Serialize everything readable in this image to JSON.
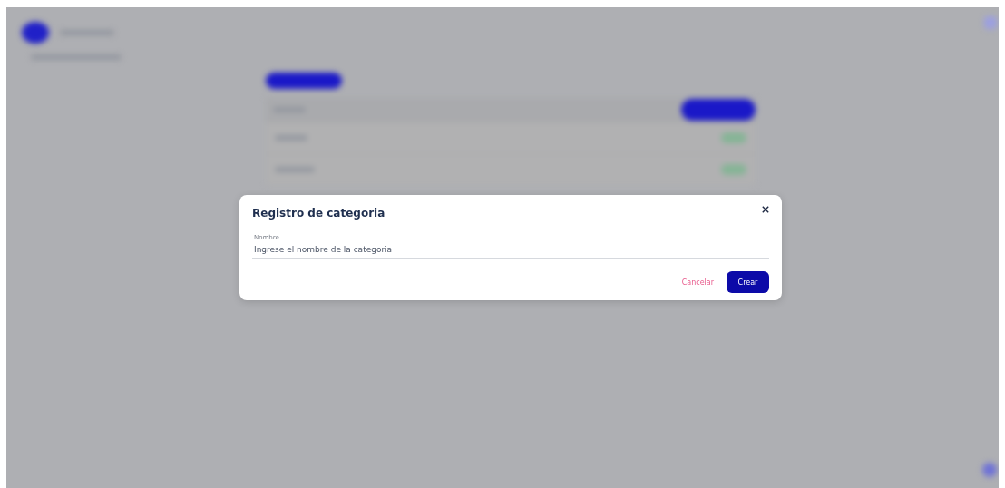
{
  "dialog": {
    "title": "Registro de categoria",
    "field": {
      "label": "Nombre",
      "placeholder": "Ingrese el nombre de la categoria"
    },
    "buttons": [
      {
        "label": "Cancelar",
        "kind": "text"
      },
      {
        "label": "Crear",
        "kind": "primary"
      }
    ]
  }
}
